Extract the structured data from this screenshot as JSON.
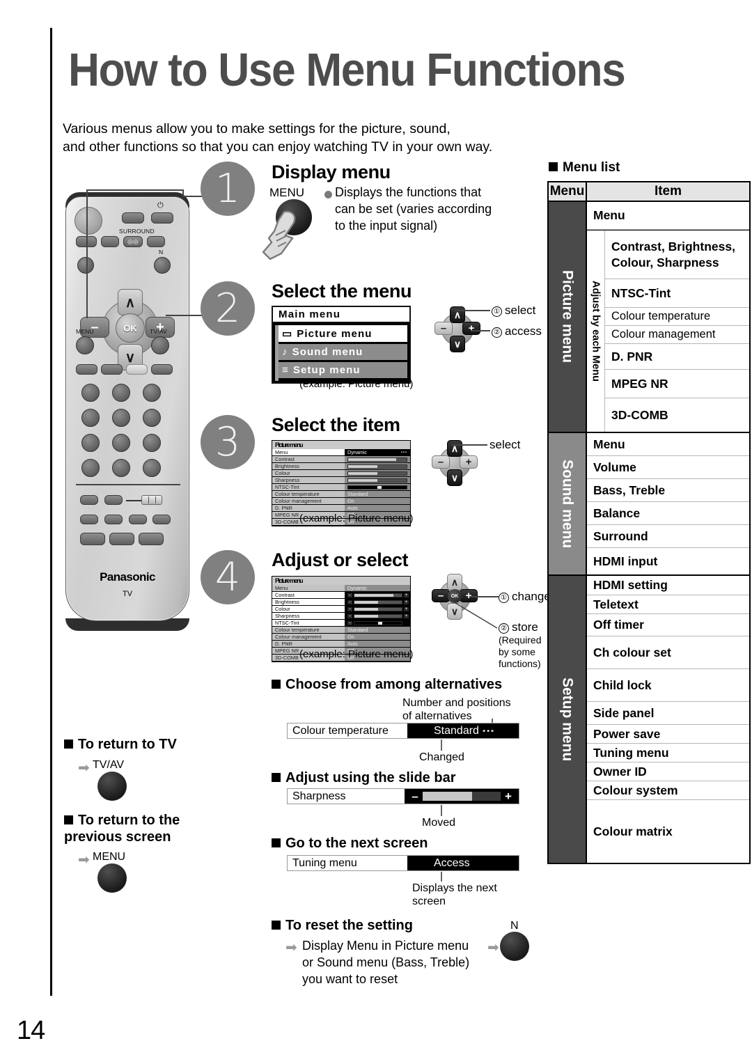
{
  "page": {
    "number": "14"
  },
  "header": {
    "title": "How to Use Menu Functions",
    "intro_line1": "Various menus allow you to make settings for the picture, sound,",
    "intro_line2": "and other functions so that you can enjoy watching TV in your own way."
  },
  "remote": {
    "brand": "Panasonic",
    "model_mark": "TV",
    "labels": {
      "surround": "SURROUND",
      "menu": "MENU",
      "tvav": "TV/AV",
      "n": "N",
      "ok": "OK",
      "minus": "–",
      "plus": "+",
      "up": "∧",
      "down": "∨",
      "power": "⏻"
    }
  },
  "steps": [
    {
      "number": "1",
      "heading": "Display menu",
      "button_label": "MENU",
      "description": "Displays the functions that can be set (varies according to the input signal)"
    },
    {
      "number": "2",
      "heading": "Select the menu",
      "osd": {
        "header": "Main menu",
        "items": [
          {
            "icon": "▭",
            "label": "Picture menu",
            "selected": true
          },
          {
            "icon": "♪",
            "label": "Sound menu",
            "selected": false
          },
          {
            "icon": "≡",
            "label": "Setup menu",
            "selected": false
          }
        ],
        "caption": "(example: Picture menu)"
      },
      "annotations": [
        {
          "num": "①",
          "text": "select"
        },
        {
          "num": "②",
          "text": "access"
        }
      ]
    },
    {
      "number": "3",
      "heading": "Select the item",
      "annotations": [
        {
          "num": "",
          "text": "select"
        }
      ],
      "caption": "(example: Picture menu)"
    },
    {
      "number": "4",
      "heading": "Adjust or select",
      "annotations": [
        {
          "num": "①",
          "text": "change"
        },
        {
          "num": "②",
          "text": "store"
        }
      ],
      "store_note": "(Required by some functions)",
      "caption": "(example: Picture menu)"
    }
  ],
  "picture_osd": {
    "title": "Picture menu",
    "rows": [
      {
        "name": "Menu",
        "value": "Dynamic",
        "type": "text"
      },
      {
        "name": "Contrast",
        "value": "",
        "type": "bar",
        "fill": 82
      },
      {
        "name": "Brightness",
        "value": "",
        "type": "bar",
        "fill": 50
      },
      {
        "name": "Colour",
        "value": "",
        "type": "bar",
        "fill": 50
      },
      {
        "name": "Sharpness",
        "value": "",
        "type": "bar",
        "fill": 50
      },
      {
        "name": "NTSC-Tint",
        "value": "",
        "type": "mark",
        "fill": 50
      },
      {
        "name": "Colour temperature",
        "value": "Standard",
        "type": "text"
      },
      {
        "name": "Colour management",
        "value": "On",
        "type": "text"
      },
      {
        "name": "D. PNR",
        "value": "Auto",
        "type": "text"
      },
      {
        "name": "MPEG NR",
        "value": "Off",
        "type": "text"
      },
      {
        "name": "3D-COMB",
        "value": "On",
        "type": "text"
      }
    ]
  },
  "return_sections": [
    {
      "heading": "To return to TV",
      "button_label": "TV/AV"
    },
    {
      "heading": "To return to the previous screen",
      "button_label": "MENU"
    }
  ],
  "bottom_sections": {
    "alternatives": {
      "heading": "Choose from among alternatives",
      "note_top": "Number and positions of alternatives",
      "strip_label": "Colour temperature",
      "strip_value": "Standard",
      "note_bottom": "Changed"
    },
    "slidebar": {
      "heading": "Adjust using the slide bar",
      "strip_label": "Sharpness",
      "minus": "–",
      "plus": "+",
      "note_bottom": "Moved"
    },
    "nextscreen": {
      "heading": "Go to the next screen",
      "strip_label": "Tuning menu",
      "strip_value": "Access",
      "note_bottom": "Displays the next screen"
    },
    "reset": {
      "heading": "To reset the setting",
      "text": "Display Menu in Picture menu or Sound menu (Bass, Treble) you want to reset",
      "button_label": "N"
    }
  },
  "menu_list": {
    "heading": "Menu list",
    "columns": {
      "menu": "Menu",
      "item": "Item"
    },
    "sections": [
      {
        "name": "Picture menu",
        "lead_rows": [
          "Menu"
        ],
        "sub_label": "Adjust by each Menu",
        "sub_rows": [
          "Contrast, Brightness, Colour, Sharpness",
          "NTSC-Tint",
          "Colour temperature",
          "Colour management",
          "D. PNR",
          "MPEG NR",
          "3D-COMB"
        ]
      },
      {
        "name": "Sound menu",
        "rows": [
          "Menu",
          "Volume",
          "Bass, Treble",
          "Balance",
          "Surround",
          "HDMI input"
        ]
      },
      {
        "name": "Setup menu",
        "rows": [
          "HDMI setting",
          "Teletext",
          "Off timer",
          "Ch colour set",
          "Child lock",
          "Side panel",
          "Power save",
          "Tuning menu",
          "Owner ID",
          "Colour system",
          "Colour matrix"
        ]
      }
    ]
  }
}
